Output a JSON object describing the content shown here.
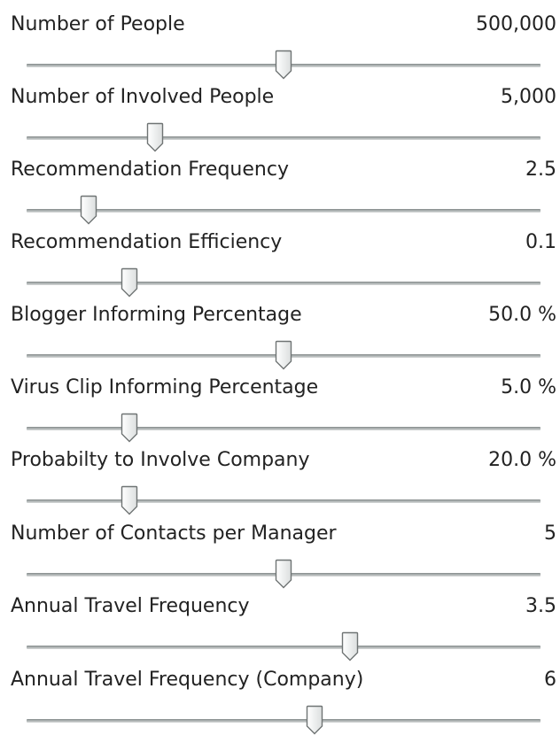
{
  "sliders": [
    {
      "label": "Number of People",
      "value": "500,000",
      "position": 0.5
    },
    {
      "label": "Number of Involved People",
      "value": "5,000",
      "position": 0.25
    },
    {
      "label": "Recommendation Frequency",
      "value": "2.5",
      "position": 0.12
    },
    {
      "label": "Recommendation Efficiency",
      "value": "0.1",
      "position": 0.2
    },
    {
      "label": "Blogger Informing Percentage",
      "value": "50.0 %",
      "position": 0.5
    },
    {
      "label": "Virus Clip Informing Percentage",
      "value": "5.0 %",
      "position": 0.2
    },
    {
      "label": "Probabilty to Involve Company",
      "value": "20.0 %",
      "position": 0.2
    },
    {
      "label": "Number of Contacts per Manager",
      "value": "5",
      "position": 0.5
    },
    {
      "label": "Annual Travel Frequency",
      "value": "3.5",
      "position": 0.63
    },
    {
      "label": "Annual Travel Frequency (Company)",
      "value": "6",
      "position": 0.56
    }
  ],
  "colors": {
    "text": "#222222",
    "track": "#9aa0a0",
    "thumb_fill": "#f4f4f4",
    "thumb_border": "#6f7474"
  },
  "icons": {
    "thumb": "slider-thumb-icon"
  }
}
